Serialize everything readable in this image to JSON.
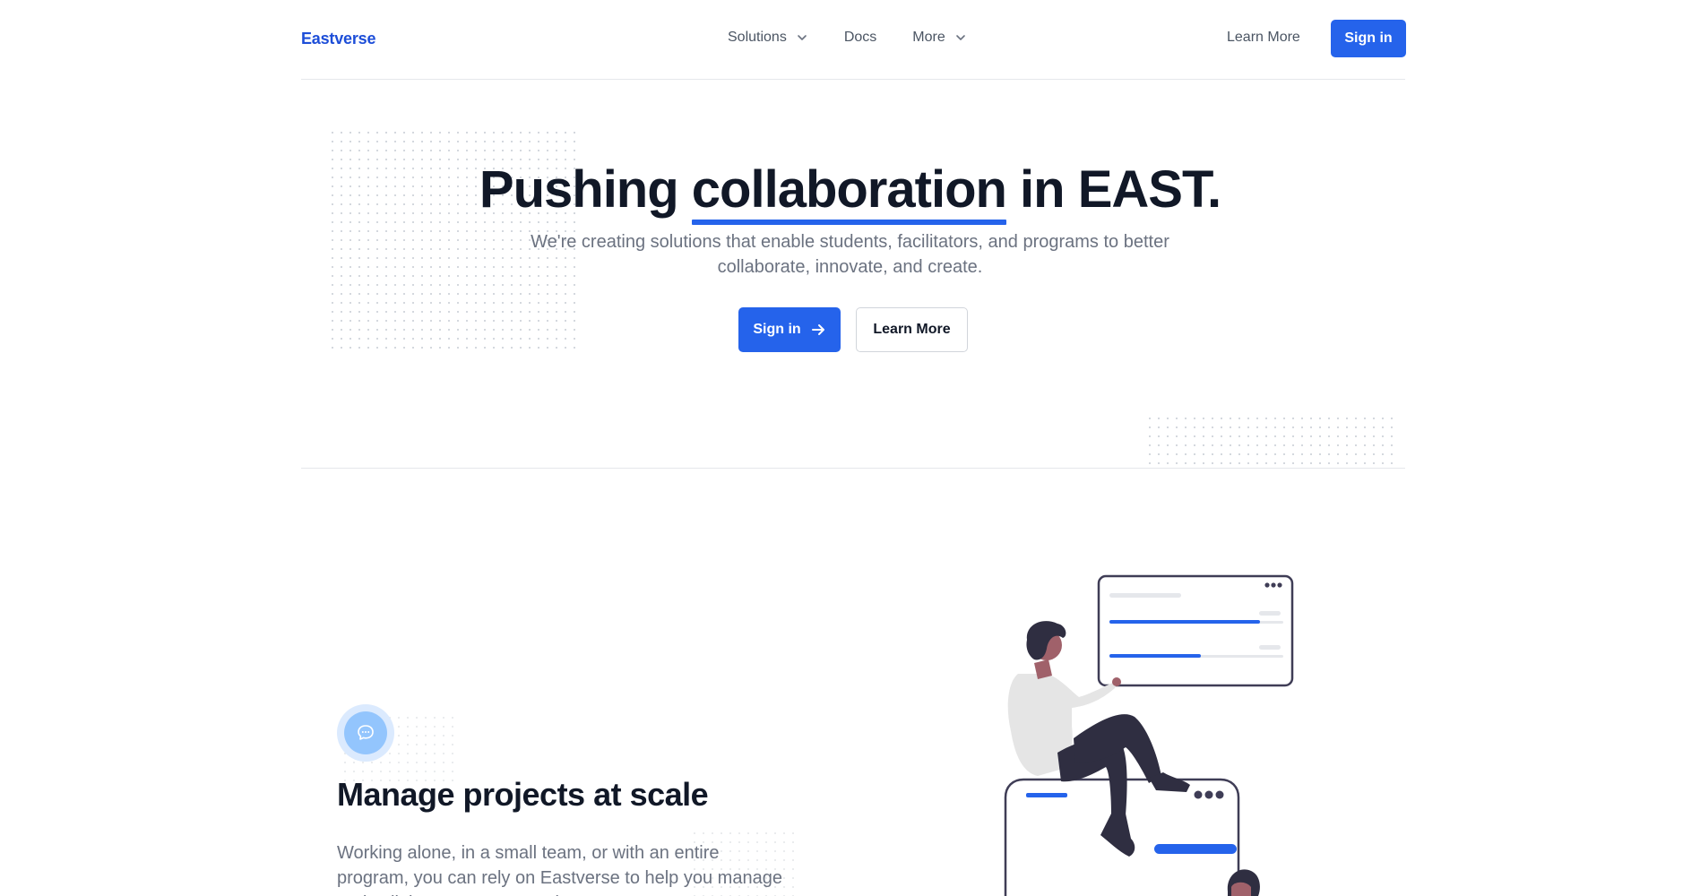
{
  "nav": {
    "brand": "Eastverse",
    "menu": [
      {
        "label": "Solutions",
        "has_dropdown": true
      },
      {
        "label": "Docs",
        "has_dropdown": false
      },
      {
        "label": "More",
        "has_dropdown": true
      }
    ],
    "learn_more": "Learn More",
    "sign_in": "Sign in"
  },
  "hero": {
    "title_before": "Pushing ",
    "title_highlight": "collaboration",
    "title_after": " in EAST.",
    "subtitle": "We're creating solutions that enable students, facilitators, and programs to better collaborate, innovate, and create.",
    "primary_button": "Sign in",
    "secondary_button": "Learn More"
  },
  "feature": {
    "icon": "chat-bubble-icon",
    "title": "Manage projects at scale",
    "text": "Working alone, in a small team, or with an entire program, you can rely on Eastverse to help you manage and collaborate on your projects."
  },
  "colors": {
    "accent": "#2563eb",
    "brand": "#1d4ed8",
    "text_dark": "#111827",
    "text_muted": "#6b7280"
  }
}
